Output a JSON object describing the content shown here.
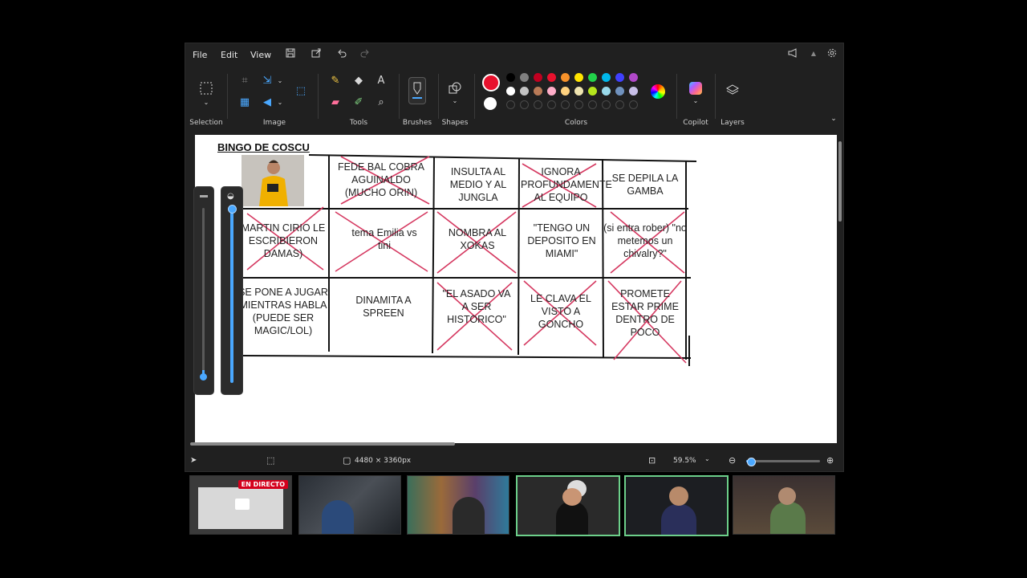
{
  "menu": {
    "file": "File",
    "edit": "Edit",
    "view": "View"
  },
  "ribbon": {
    "selection": "Selection",
    "image": "Image",
    "tools": "Tools",
    "brushes": "Brushes",
    "shapes": "Shapes",
    "colors": "Colors",
    "copilot": "Copilot",
    "layers": "Layers",
    "text_tool_glyph": "A"
  },
  "palette": {
    "primary": "#e8112d",
    "secondary": "#ffffff",
    "row1": [
      "#000000",
      "#808080",
      "#c00020",
      "#e8112d",
      "#f7922a",
      "#ffe400",
      "#22d24a",
      "#00b7eb",
      "#4040ff",
      "#b048c8"
    ],
    "row2": [
      "#ffffff",
      "#c3c3c3",
      "#b97a57",
      "#ffaec9",
      "#ffd27f",
      "#efe4b0",
      "#b5e61d",
      "#99d9ea",
      "#7092be",
      "#c8bfe7"
    ]
  },
  "bingo": {
    "title": "BINGO DE COSCU",
    "cells": [
      "FEDE BAL COBRA AGUINALDO (MUCHO ORIN)",
      "INSULTA AL MEDIO Y AL JUNGLA",
      "IGNORA PROFUNDAMENTE AL EQUIPO",
      "SE DEPILA LA GAMBA",
      "MARTIN CIRIO LE ESCRIBIERON DAMAS)",
      "tema Emilia vs tini",
      "NOMBRA AL XOKAS",
      "\"TENGO UN DEPOSITO EN MIAMI\"",
      "(si entra rober) \"no metemos un chivalry?\"",
      "SE PONE A JUGAR MIENTRAS HABLA (PUEDE SER MAGIC/LOL)",
      "DINAMITA A SPREEN",
      "\"EL ASADO VA A SER HISTORICO\"",
      "LE CLAVA EL VISTO A GONCHO",
      "PROMETE ESTAR PRIME DENTRO DE POCO"
    ]
  },
  "status": {
    "canvas_size": "4480 × 3360px",
    "zoom": "59.5%"
  },
  "zoom_fraction": 0.05,
  "streams": {
    "live_label": "EN DIRECTO"
  }
}
